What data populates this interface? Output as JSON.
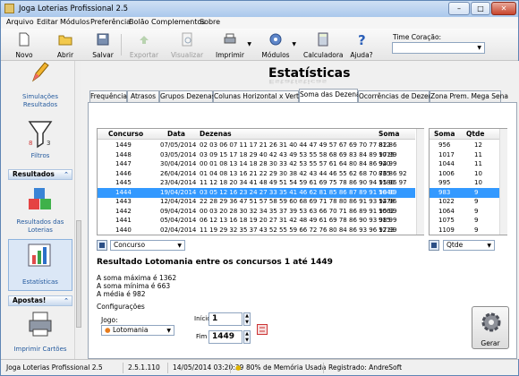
{
  "window": {
    "title": "Joga Loterias Profissional 2.5"
  },
  "menu": [
    "Arquivo",
    "Editar",
    "Módulos",
    "Preferência",
    "Bolão",
    "Complementos",
    "Sobre"
  ],
  "toolbar": {
    "novo": "Novo",
    "abrir": "Abrir",
    "salvar": "Salvar",
    "exportar": "Exportar",
    "visualizar": "Visualizar",
    "imprimir": "Imprimir",
    "modulos": "Módulos",
    "calculadora": "Calculadora",
    "ajuda": "Ajuda?",
    "time_label": "Time Coração:",
    "time_value": ""
  },
  "sidebar": {
    "simulacoes": "Simulações Resultados",
    "filtros": "Filtros",
    "resultados_header": "Resultados",
    "resultados_lotes": "Resultados das Loterias",
    "estatisticas": "Estatísticas",
    "apostas_header": "Apostas!",
    "imprimir_cartoes": "Imprimir Cartões"
  },
  "main": {
    "heading": "Estatísticas",
    "tabs": [
      "Frequência",
      "Atrasos",
      "Grupos Dezenas",
      "Colunas Horizontal x Vertical",
      "Soma das Dezenas",
      "Ocorrências de Dezenas",
      "Zona Prem. Mega Sena"
    ],
    "active_tab": 4
  },
  "table": {
    "columns": [
      "Concurso",
      "Data",
      "Dezenas",
      "Soma"
    ],
    "rows": [
      [
        "1449",
        "07/05/2014",
        "02 03 06 07 11 17 21 26 31 40 44 47 49 57 67 69 70 77 82 86",
        "812"
      ],
      [
        "1448",
        "03/05/2014",
        "03 09 15 17 18 29 40 42 43 49 53 55 58 68 69 83 84 89 97 99",
        "1015"
      ],
      [
        "1447",
        "30/04/2014",
        "00 01 08 13 14 18 28 30 33 42 53 55 57 61 64 80 84 86 94 99",
        "920"
      ],
      [
        "1446",
        "26/04/2014",
        "01 04 08 13 16 21 22 29 30 38 42 43 44 46 55 62 68 70 76 86 92",
        "835"
      ],
      [
        "1445",
        "23/04/2014",
        "11 12 18 20 34 41 48 49 51 54 59 61 69 75 78 86 90 94 95 96 97",
        "1180"
      ],
      [
        "1444",
        "19/04/2014",
        "03 05 12 16 23 24 27 33 35 41 46 62 81 85 86 87 89 91 98 99",
        "1040"
      ],
      [
        "1443",
        "12/04/2014",
        "22 28 29 36 47 51 57 58 59 60 68 69 71 78 80 86 91 93 94 96",
        "1278"
      ],
      [
        "1442",
        "09/04/2014",
        "00 03 20 28 30 32 34 35 37 39 53 63 66 70 71 86 89 91 95 99",
        "1062"
      ],
      [
        "1441",
        "05/04/2014",
        "06 12 13 16 18 19 20 27 31 42 48 49 61 69 78 86 90 93 98 99",
        "915"
      ],
      [
        "1440",
        "02/04/2014",
        "11 19 29 32 35 37 43 52 55 59 66 72 76 80 84 86 93 96 97 99",
        "1213"
      ]
    ],
    "selected_row": 5
  },
  "soma_table": {
    "columns": [
      "Soma",
      "Qtde"
    ],
    "rows": [
      [
        "956",
        "12"
      ],
      [
        "1017",
        "11"
      ],
      [
        "1044",
        "11"
      ],
      [
        "1006",
        "10"
      ],
      [
        "995",
        "10"
      ],
      [
        "983",
        "9"
      ],
      [
        "1022",
        "9"
      ],
      [
        "1064",
        "9"
      ],
      [
        "1075",
        "9"
      ],
      [
        "1109",
        "9"
      ]
    ],
    "selected_row": 5
  },
  "left_combo": "Concurso",
  "right_combo": "Qtde",
  "result": {
    "title": "Resultado Lotomania entre os concursos 1 até 1449",
    "max": "A soma máxima é 1362",
    "min": "A soma mínima é 663",
    "avg": "A média é 982"
  },
  "config": {
    "label": "Configurações",
    "jogo_label": "Jogo:",
    "jogo_value": "Lotomania",
    "inicio_label": "Início",
    "inicio_value": "1",
    "fim_label": "Fim",
    "fim_value": "1449",
    "gerar": "Gerar"
  },
  "status": {
    "app": "Joga Loterias Profissional 2.5",
    "version": "2.5.1.110",
    "datetime": "14/05/2014 03:20:39",
    "memory": "80% de Memória Usada",
    "registered": "Registrado: AndreSoft"
  }
}
